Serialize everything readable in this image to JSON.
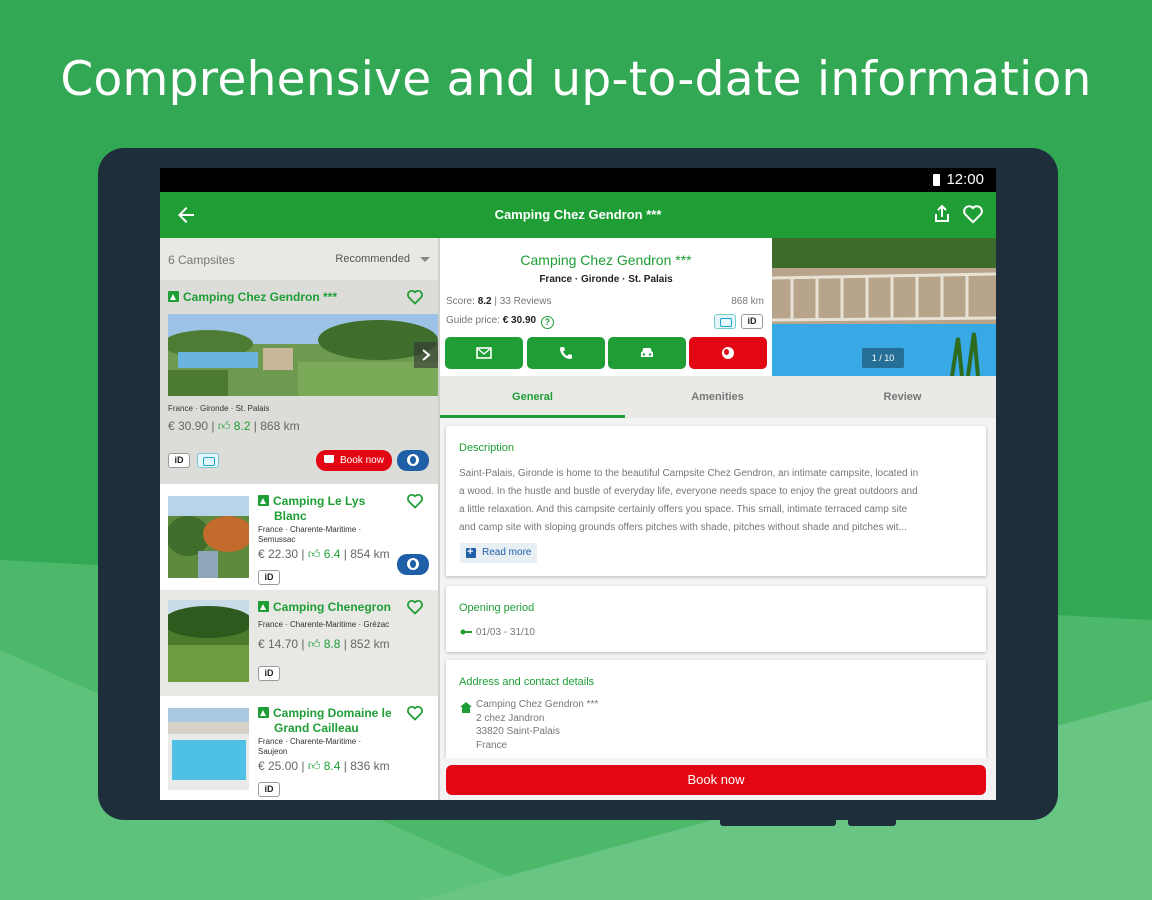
{
  "headline": "Comprehensive and up-to-date information",
  "status": {
    "time": "12:00"
  },
  "appbar": {
    "title": "Camping Chez Gendron ***"
  },
  "list": {
    "count": "6 Campsites",
    "sort": "Recommended",
    "selected": {
      "name": "Camping Chez Gendron ***",
      "location": "France · Gironde · St. Palais",
      "price": "€ 30.90",
      "score": "8.2",
      "distance": "868 km",
      "badge_id": "iD",
      "book_label": "Book now"
    },
    "items": [
      {
        "name_line1": "Camping Le Lys",
        "name_line2": "Blanc",
        "location_line1": "France · Charente-Maritime ·",
        "location_line2": "Semussac",
        "price": "€ 22.30",
        "score": "6.4",
        "distance": "854 km",
        "badge_id": "iD"
      },
      {
        "name_line1": "Camping Chenegron",
        "name_line2": "",
        "location_line1": "France · Charente-Maritime · Grézac",
        "location_line2": "",
        "price": "€ 14.70",
        "score": "8.8",
        "distance": "852 km",
        "badge_id": "iD"
      },
      {
        "name_line1": "Camping Domaine le",
        "name_line2": "Grand Cailleau",
        "location_line1": "France · Charente-Maritime ·",
        "location_line2": "Saujeon",
        "price": "€ 25.00",
        "score": "8.4",
        "distance": "836 km",
        "badge_id": "iD"
      }
    ]
  },
  "detail": {
    "name": "Camping Chez Gendron ***",
    "location": "France · Gironde · St. Palais",
    "score_label": "Score:",
    "score": "8.2",
    "reviews": "| 33 Reviews",
    "distance": "868 km",
    "price_label": "Guide price:",
    "price": "€ 30.90",
    "qmark": "?",
    "badge_id": "iD",
    "photo_counter": "1 / 10",
    "tabs": [
      "General",
      "Amenities",
      "Review"
    ],
    "description": {
      "heading": "Description",
      "lines": [
        "Saint-Palais, Gironde is home to the beautiful Campsite Chez Gendron, an intimate campsite, located in",
        "a wood. In the hustle and bustle of everyday life, everyone needs space to enjoy the great outdoors and",
        "a little relaxation. And this campsite certainly offers you space. This small, intimate terraced camp site",
        "and camp site with sloping grounds offers pitches with shade, pitches without shade and pitches wit..."
      ],
      "read_more": "Read more"
    },
    "opening": {
      "heading": "Opening period",
      "value": "01/03 - 31/10"
    },
    "address": {
      "heading": "Address and contact details",
      "lines": [
        "Camping Chez Gendron ***",
        "2 chez Jandron",
        "33820 Saint-Palais",
        "France"
      ]
    },
    "book_label": "Book now"
  },
  "colors": {
    "brand_green": "#1e9e35",
    "book_red": "#e30613",
    "globe_blue": "#1f5fa8"
  }
}
